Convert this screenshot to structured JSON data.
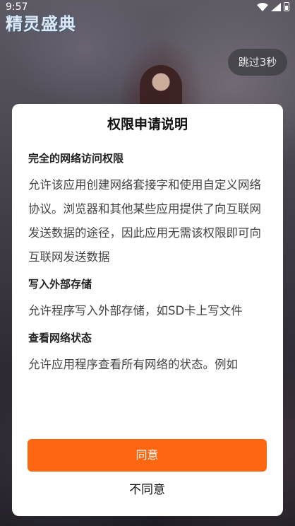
{
  "status_bar": {
    "time": "9:57"
  },
  "background": {
    "game_logo": "精灵盛典"
  },
  "skip_button": {
    "label": "跳过3秒"
  },
  "dialog": {
    "title": "权限申请说明",
    "permissions": [
      {
        "title": "完全的网络访问权限",
        "description": "允许该应用创建网络套接字和使用自定义网络协议。浏览器和其他某些应用提供了向互联网发送数据的途径，因此应用无需该权限即可向互联网发送数据"
      },
      {
        "title": "写入外部存储",
        "description": "允许程序写入外部存储，如SD卡上写文件"
      },
      {
        "title": "查看网络状态",
        "description": "允许应用程序查看所有网络的状态。例如"
      }
    ],
    "agree_label": "同意",
    "disagree_label": "不同意",
    "accent_color": "#fd6610"
  }
}
